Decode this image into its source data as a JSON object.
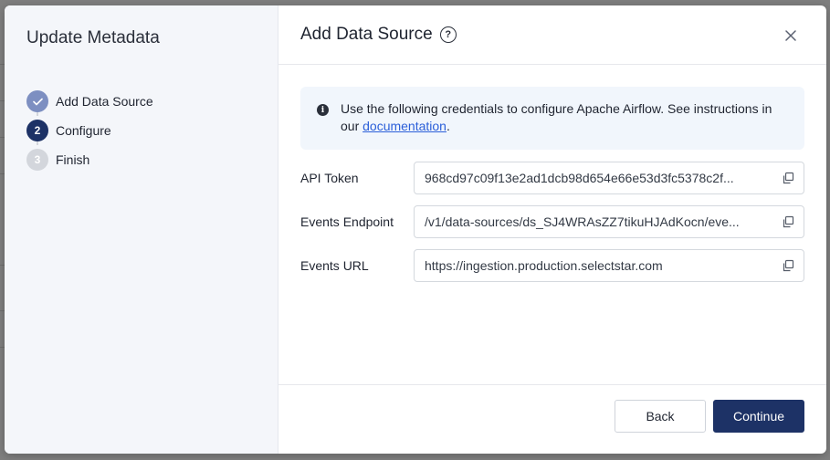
{
  "sidebar": {
    "title": "Update Metadata",
    "steps": [
      {
        "number": "",
        "label": "Add Data Source",
        "state": "done"
      },
      {
        "number": "2",
        "label": "Configure",
        "state": "active"
      },
      {
        "number": "3",
        "label": "Finish",
        "state": "todo"
      }
    ]
  },
  "main": {
    "title": "Add Data Source",
    "info": {
      "text": "Use the following credentials to configure Apache Airflow. See instructions in our ",
      "link": "documentation",
      "suffix": "."
    },
    "fields": [
      {
        "label": "API Token",
        "value": "968cd97c09f13e2ad1dcb98d654e66e53d3fc5378c2f..."
      },
      {
        "label": "Events Endpoint",
        "value": "/v1/data-sources/ds_SJ4WRAsZZ7tikuHJAdKocn/eve..."
      },
      {
        "label": "Events URL",
        "value": "https://ingestion.production.selectstar.com"
      }
    ]
  },
  "footer": {
    "back_label": "Back",
    "continue_label": "Continue"
  },
  "colors": {
    "primary": "#1d3266",
    "step_done": "#7d8fc1",
    "step_todo": "#d3d6dc",
    "info_bg": "#f1f6fc",
    "link": "#2b5fd9"
  }
}
